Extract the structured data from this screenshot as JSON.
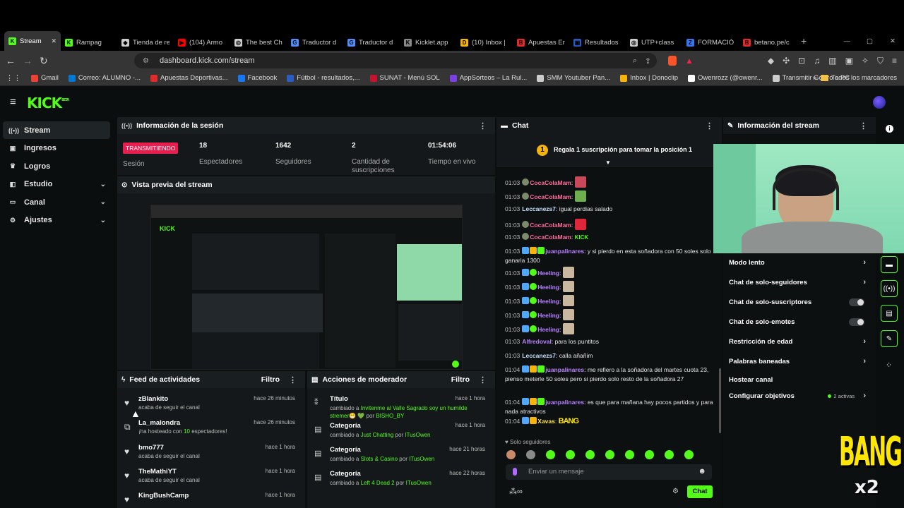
{
  "browser": {
    "tabs": [
      {
        "title": "Stream",
        "color": "#53fc18",
        "glyph": "K"
      },
      {
        "title": "Rampag",
        "color": "#53fc18",
        "glyph": "K"
      },
      {
        "title": "Tienda de re",
        "color": "#cccccc",
        "glyph": "◆"
      },
      {
        "title": "(104) Armo",
        "color": "#ff0000",
        "glyph": "▶"
      },
      {
        "title": "The best Ch",
        "color": "#cccccc",
        "glyph": "◎"
      },
      {
        "title": "Traductor d",
        "color": "#4f8ef7",
        "glyph": "G"
      },
      {
        "title": "Traductor d",
        "color": "#4f8ef7",
        "glyph": "G"
      },
      {
        "title": "Kicklet.app",
        "color": "#888888",
        "glyph": "K"
      },
      {
        "title": "(10) Inbox |",
        "color": "#f5b30b",
        "glyph": "D"
      },
      {
        "title": "Apuestas Er",
        "color": "#e32a2a",
        "glyph": "B"
      },
      {
        "title": "Resultados",
        "color": "#2a5cc4",
        "glyph": "▣"
      },
      {
        "title": "UTP+class",
        "color": "#cccccc",
        "glyph": "◎"
      },
      {
        "title": "FORMACIÓ",
        "color": "#3477f4",
        "glyph": "Z"
      },
      {
        "title": "betano.pe/c",
        "color": "#e32a2a",
        "glyph": "B"
      }
    ],
    "url": "dashboard.kick.com/stream",
    "bookmarks": [
      {
        "label": "Gmail",
        "color": "#ea4335"
      },
      {
        "label": "Correo: ALUMNO -...",
        "color": "#0078d4"
      },
      {
        "label": "Apuestas Deportivas...",
        "color": "#e32a2a"
      },
      {
        "label": "Facebook",
        "color": "#1877f2"
      },
      {
        "label": "Fútbol - resultados,...",
        "color": "#2a5cc4"
      },
      {
        "label": "SUNAT - Menú SOL",
        "color": "#c4122f"
      },
      {
        "label": "AppSorteos – La Rul...",
        "color": "#7b3fe4"
      },
      {
        "label": "SMM Youtuber Pan...",
        "color": "#cccccc"
      },
      {
        "label": "Inbox | Donoclip",
        "color": "#f5b30b"
      },
      {
        "label": "Owenrozz (@owenr...",
        "color": "#ffffff"
      },
      {
        "label": "Transmitir GoPro a PC",
        "color": "#cccccc"
      }
    ],
    "bookmarks_all": "Todos los marcadores"
  },
  "sidebar": {
    "items": [
      {
        "label": "Stream",
        "icon": "radio-icon",
        "active": true
      },
      {
        "label": "Ingresos",
        "icon": "wallet-icon"
      },
      {
        "label": "Logros",
        "icon": "trophy-icon"
      },
      {
        "label": "Estudio",
        "icon": "studio-icon",
        "chevron": true
      },
      {
        "label": "Canal",
        "icon": "channel-icon",
        "chevron": true
      },
      {
        "label": "Ajustes",
        "icon": "gear-icon",
        "chevron": true
      }
    ]
  },
  "session": {
    "title": "Información de la sesión",
    "live_badge": "TRANSMITIENDO",
    "live_label": "Sesión",
    "stats": [
      {
        "value": "18",
        "label": "Espectadores"
      },
      {
        "value": "1642",
        "label": "Seguidores"
      },
      {
        "value": "2",
        "label": "Cantidad de suscripciones"
      },
      {
        "value": "01:54:06",
        "label": "Tiempo en vivo"
      }
    ]
  },
  "preview": {
    "title": "Vista previa del stream"
  },
  "feed": {
    "title": "Feed de actividades",
    "filter": "Filtro",
    "rows": [
      {
        "name": "zBlankito",
        "desc": "acaba de seguir el canal",
        "time": "hace 26 minutos",
        "icon": "heart"
      },
      {
        "name": "La_malondra",
        "desc": "¡ha hosteado con",
        "count": "10",
        "desc2": "espectadores!",
        "time": "hace 26 minutos",
        "icon": "host"
      },
      {
        "name": "bmo777",
        "desc": "acaba de seguir el canal",
        "time": "hace 1 hora",
        "icon": "heart"
      },
      {
        "name": "TheMathiYT",
        "desc": "acaba de seguir el canal",
        "time": "hace 1 hora",
        "icon": "heart"
      },
      {
        "name": "KingBushCamp",
        "desc": "",
        "time": "hace 1 hora",
        "icon": "heart"
      }
    ]
  },
  "mod": {
    "title": "Acciones de moderador",
    "filter": "Filtro",
    "rows": [
      {
        "name": "Título",
        "pre": "cambiado a",
        "value": "Invitenme al Valle Sagrado soy un humilde stremer😁 💚",
        "by": "por",
        "user": "BISHO_BY",
        "time": "hace 1 hora"
      },
      {
        "name": "Categoría",
        "pre": "cambiado a",
        "value": "Just Chatting",
        "by": "por",
        "user": "ITusOwen",
        "time": "hace 1 hora"
      },
      {
        "name": "Categoría",
        "pre": "cambiado a",
        "value": "Slots & Casino",
        "by": "por",
        "user": "ITusOwen",
        "time": "hace 21 horas"
      },
      {
        "name": "Categoría",
        "pre": "cambiado a",
        "value": "Left 4 Dead 2",
        "by": "por",
        "user": "ITusOwen",
        "time": "hace 22 horas"
      }
    ]
  },
  "chat": {
    "title": "Chat",
    "pinned": "Regala 1 suscripción para tomar la posición 1",
    "pinned_rank": "1",
    "messages": [
      {
        "time": "01:03",
        "user": "CocaColaMam",
        "color": "#ff6b9a",
        "text": ":",
        "emote": "#c9495a"
      },
      {
        "time": "01:03",
        "user": "CocaColaMam",
        "color": "#ff6b9a",
        "text": ":",
        "emote": "#6fae4f"
      },
      {
        "time": "01:03",
        "user": "Leccanezs7",
        "color": "#c7e0ff",
        "text": ": igual perdias salado"
      },
      {
        "time": "01:03",
        "user": "CocaColaMam",
        "color": "#ff6b9a",
        "text": ":",
        "emote": "#e0263b"
      },
      {
        "time": "01:03",
        "user": "CocaColaMam",
        "color": "#ff6b9a",
        "text": ":",
        "kick": "KICK"
      },
      {
        "time": "01:03",
        "user": "juanpalinares",
        "color": "#b981ff",
        "text": ": y si pierdo en esta soñadora con 50 soles solo ganaria 1300"
      },
      {
        "time": "01:03",
        "user": "Heeling",
        "color": "#b981ff",
        "text": ":",
        "emote": "#c9b7a0"
      },
      {
        "time": "01:03",
        "user": "Heeling",
        "color": "#b981ff",
        "text": ":",
        "emote": "#c9b7a0"
      },
      {
        "time": "01:03",
        "user": "Heeling",
        "color": "#b981ff",
        "text": ":",
        "emote": "#c9b7a0"
      },
      {
        "time": "01:03",
        "user": "Heeling",
        "color": "#b981ff",
        "text": ":",
        "emote": "#c9b7a0"
      },
      {
        "time": "01:03",
        "user": "Heeling",
        "color": "#b981ff",
        "text": ":",
        "emote": "#c9b7a0"
      },
      {
        "time": "01:03",
        "user": "Alfredoval",
        "color": "#b981ff",
        "text": ": para los puntitos"
      },
      {
        "time": "01:03",
        "user": "Leccanezs7",
        "color": "#c7e0ff",
        "text": ": calla añañim"
      },
      {
        "time": "01:04",
        "user": "juanpalinares",
        "color": "#b981ff",
        "text": ": me refiero a la soñadora del martes cuota 23, pienso meterle 50 soles pero si pierdo solo resto de la soñadora 27"
      },
      {
        "time": "01:04",
        "user": "juanpalinares",
        "color": "#b981ff",
        "text": ": es que para mañana hay pocos partidos y para nada atractivos"
      },
      {
        "time": "01:04",
        "user": "Xavas",
        "color": "#ffe34d",
        "text": ":",
        "bang": "BANG"
      }
    ],
    "followers_only": "Solo seguidores",
    "input_placeholder": "Enviar un mensaje",
    "send": "Chat"
  },
  "stream_info": {
    "title": "Información del stream",
    "settings": [
      {
        "label": "Modo lento",
        "type": "arrow"
      },
      {
        "label": "Chat de solo-seguidores",
        "type": "arrow"
      },
      {
        "label": "Chat de solo-suscriptores",
        "type": "toggle"
      },
      {
        "label": "Chat de solo-emotes",
        "type": "toggle"
      },
      {
        "label": "Restricción de edad",
        "type": "arrow"
      },
      {
        "label": "Palabras baneadas",
        "type": "arrow"
      },
      {
        "label": "Hostear canal",
        "type": "none"
      },
      {
        "label": "Configurar objetivos",
        "type": "arrow",
        "extra": "2 activas"
      }
    ]
  },
  "overlay": {
    "bang": "BANG",
    "multiplier": "x2"
  },
  "colors": {
    "accent": "#53fc18",
    "live": "#e91e4e",
    "bg": "#0b0e0f",
    "panel": "#14181a"
  }
}
